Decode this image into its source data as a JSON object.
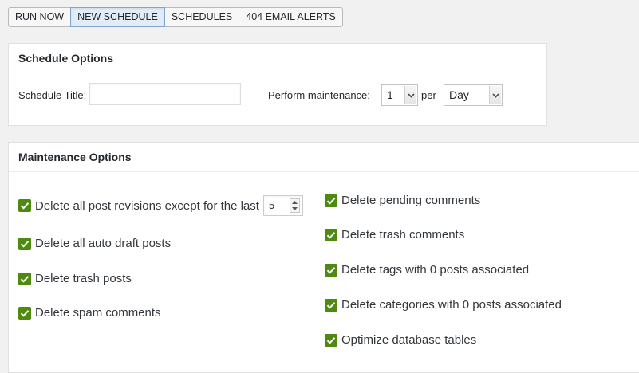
{
  "tabs": [
    {
      "label": "RUN NOW",
      "active": false
    },
    {
      "label": "NEW SCHEDULE",
      "active": true
    },
    {
      "label": "SCHEDULES",
      "active": false
    },
    {
      "label": "404 EMAIL ALERTS",
      "active": false
    }
  ],
  "schedule_options": {
    "heading": "Schedule Options",
    "title_label": "Schedule Title:",
    "title_value": "",
    "title_placeholder": "",
    "maintenance_label": "Perform maintenance:",
    "frequency_value": "1",
    "per_label": "per",
    "period_value": "Day"
  },
  "maintenance_options": {
    "heading": "Maintenance Options",
    "left": [
      {
        "label": "Delete all post revisions except for the last",
        "checked": true,
        "number_value": "5"
      },
      {
        "label": "Delete all auto draft posts",
        "checked": true
      },
      {
        "label": "Delete trash posts",
        "checked": true
      },
      {
        "label": "Delete spam comments",
        "checked": true
      }
    ],
    "right": [
      {
        "label": "Delete pending comments",
        "checked": true
      },
      {
        "label": "Delete trash comments",
        "checked": true
      },
      {
        "label": "Delete tags with 0 posts associated",
        "checked": true
      },
      {
        "label": "Delete categories with 0 posts associated",
        "checked": true
      },
      {
        "label": "Optimize database tables",
        "checked": true
      }
    ]
  },
  "colors": {
    "checkbox": "#4f8a10",
    "active_tab_bg": "#e2ecf6",
    "active_tab_border": "#7fa6cf",
    "page_bg": "#f1f1f1"
  }
}
